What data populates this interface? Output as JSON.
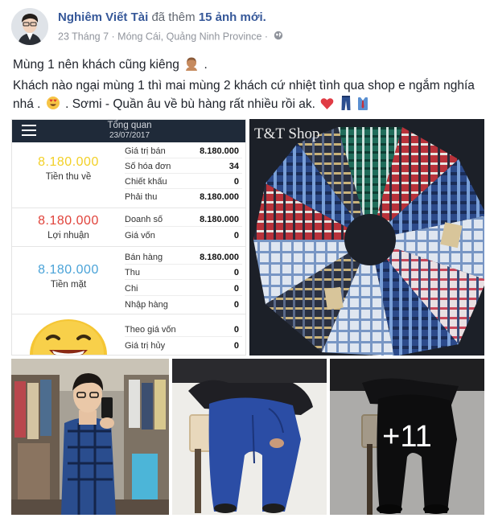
{
  "post": {
    "author_name": "Nghiêm Viết Tài",
    "author_action": "đã thêm",
    "photo_count_text": "15 ảnh mới.",
    "date": "23 Tháng 7",
    "separator": "·",
    "location": "Móng Cái, Quảng Ninh Province",
    "separator2": "·",
    "privacy_icon": "globe-icon",
    "line1": "Mùng 1 nên khách cũng kiêng",
    "line2a": "Khách nào ngại mùng 1 thì mai mùng 2 khách cứ nhiệt tình qua shop e ngắm nghía nhá .",
    "line2b": ". Sơmi - Quần âu về bù hàng rất nhiều rồi ak.",
    "emojis": [
      "person-emoji",
      "heart-eyes-emoji",
      "heart-emoji",
      "jeans-emoji",
      "shirt-emoji"
    ]
  },
  "app": {
    "title": "Tổng quan",
    "date": "23/07/2017",
    "sections": [
      {
        "big_value": "8.180.000",
        "big_label": "Tiền thu về",
        "color": "#f2d027",
        "rows": [
          {
            "label": "Giá trị bán",
            "value": "8.180.000"
          },
          {
            "label": "Số hóa đơn",
            "value": "34"
          },
          {
            "label": "Chiết khấu",
            "value": "0"
          },
          {
            "label": "Phải thu",
            "value": "8.180.000"
          }
        ]
      },
      {
        "big_value": "8.180.000",
        "big_label": "Lợi nhuận",
        "color": "#e0423a",
        "rows": [
          {
            "label": "Doanh số",
            "value": "8.180.000"
          },
          {
            "label": "Giá vốn",
            "value": "0"
          }
        ]
      },
      {
        "big_value": "8.180.000",
        "big_label": "Tiền mặt",
        "color": "#4aa3d8",
        "rows": [
          {
            "label": "Bán hàng",
            "value": "8.180.000"
          },
          {
            "label": "Thu",
            "value": "0"
          },
          {
            "label": "Chi",
            "value": "0"
          },
          {
            "label": "Nhập hàng",
            "value": "0"
          }
        ]
      },
      {
        "rows": [
          {
            "label": "Theo giá vốn",
            "value": "0"
          },
          {
            "label": "Giá trị hủy",
            "value": "0"
          }
        ]
      }
    ]
  },
  "photos": {
    "shop_label": "T&T Shop",
    "more_count": "+11"
  },
  "colors": {
    "link": "#365899",
    "meta": "#90949c",
    "text": "#1d2129"
  }
}
